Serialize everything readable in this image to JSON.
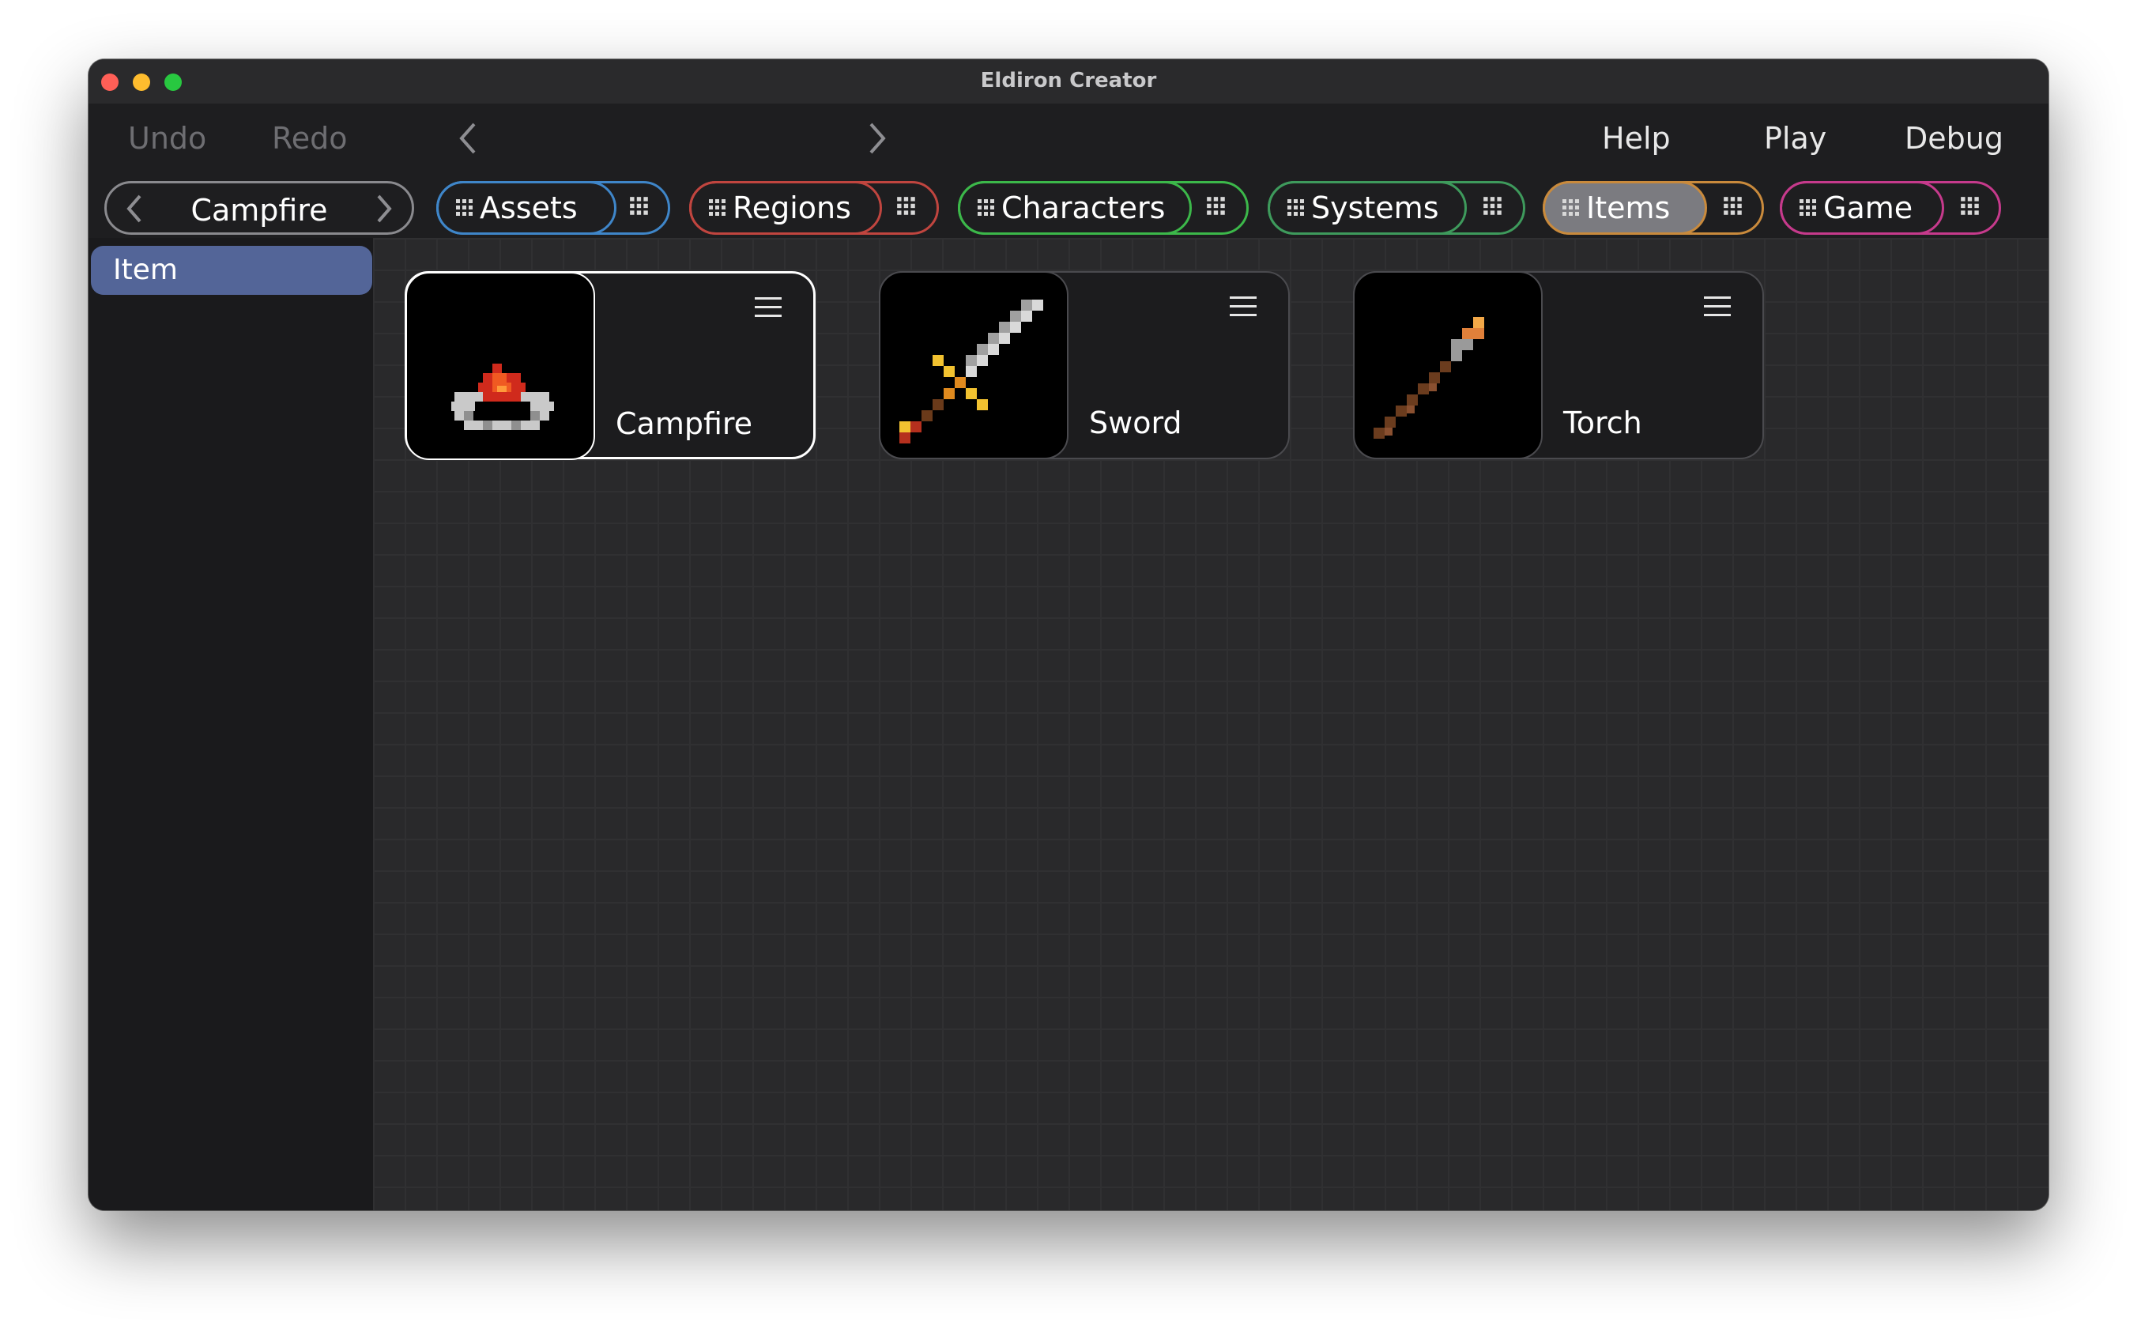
{
  "window": {
    "title": "Eldiron Creator"
  },
  "toolbar": {
    "undo_label": "Undo",
    "redo_label": "Redo",
    "help_label": "Help",
    "play_label": "Play",
    "debug_label": "Debug"
  },
  "project": {
    "name": "Campfire"
  },
  "tabs": [
    {
      "label": "Assets",
      "color": "#3f86c9",
      "active": false
    },
    {
      "label": "Regions",
      "color": "#c0453f",
      "active": false
    },
    {
      "label": "Characters",
      "color": "#3cb84a",
      "active": false
    },
    {
      "label": "Systems",
      "color": "#3e9a5c",
      "active": false
    },
    {
      "label": "Items",
      "color": "#c98a3c",
      "active": true
    },
    {
      "label": "Game",
      "color": "#c63a8c",
      "active": false
    }
  ],
  "sidebar": {
    "items": [
      {
        "label": "Item",
        "selected": true
      }
    ]
  },
  "cards": [
    {
      "label": "Campfire",
      "icon": "campfire-icon",
      "selected": true
    },
    {
      "label": "Sword",
      "icon": "sword-icon",
      "selected": false
    },
    {
      "label": "Torch",
      "icon": "torch-icon",
      "selected": false
    }
  ]
}
